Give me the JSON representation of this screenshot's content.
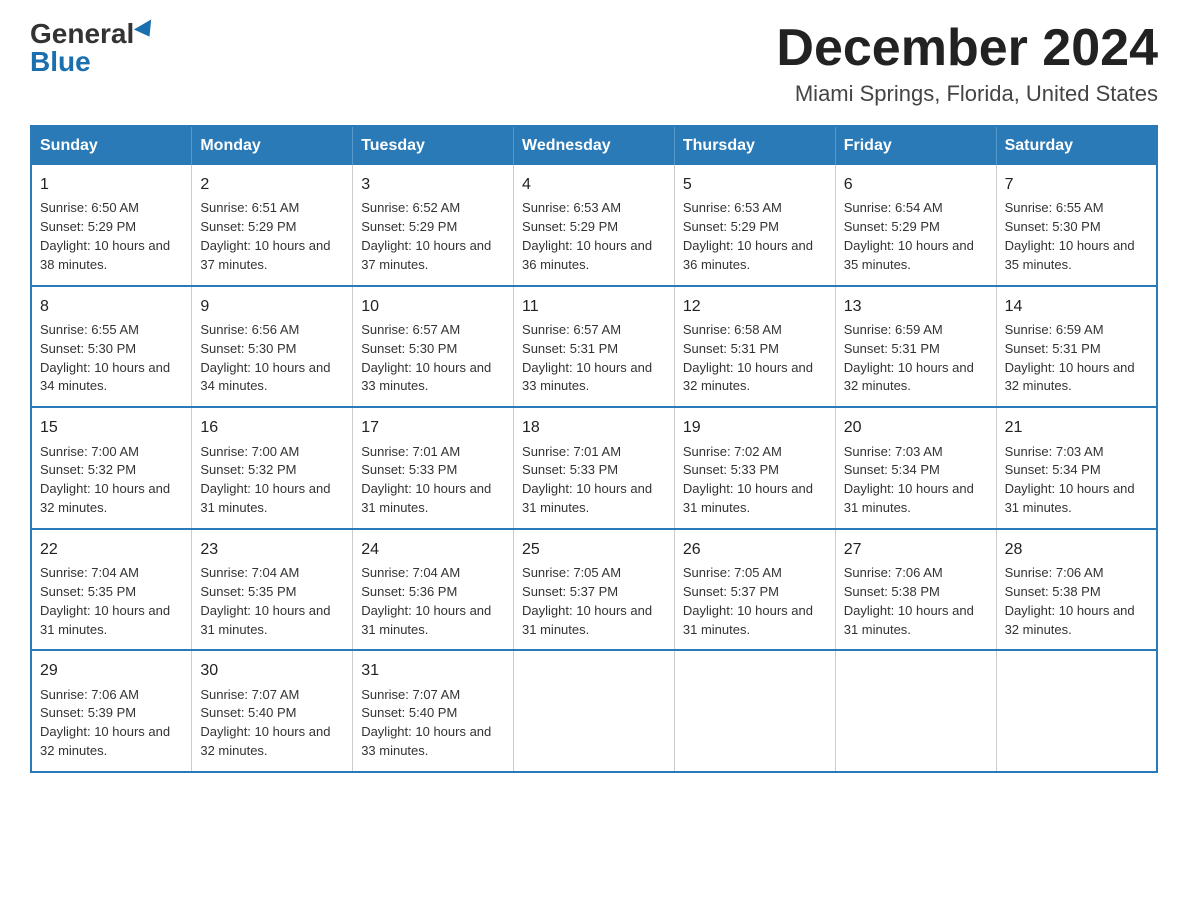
{
  "logo": {
    "general": "General",
    "blue": "Blue"
  },
  "title": "December 2024",
  "subtitle": "Miami Springs, Florida, United States",
  "days_of_week": [
    "Sunday",
    "Monday",
    "Tuesday",
    "Wednesday",
    "Thursday",
    "Friday",
    "Saturday"
  ],
  "weeks": [
    [
      {
        "day": "1",
        "sunrise": "6:50 AM",
        "sunset": "5:29 PM",
        "daylight": "10 hours and 38 minutes."
      },
      {
        "day": "2",
        "sunrise": "6:51 AM",
        "sunset": "5:29 PM",
        "daylight": "10 hours and 37 minutes."
      },
      {
        "day": "3",
        "sunrise": "6:52 AM",
        "sunset": "5:29 PM",
        "daylight": "10 hours and 37 minutes."
      },
      {
        "day": "4",
        "sunrise": "6:53 AM",
        "sunset": "5:29 PM",
        "daylight": "10 hours and 36 minutes."
      },
      {
        "day": "5",
        "sunrise": "6:53 AM",
        "sunset": "5:29 PM",
        "daylight": "10 hours and 36 minutes."
      },
      {
        "day": "6",
        "sunrise": "6:54 AM",
        "sunset": "5:29 PM",
        "daylight": "10 hours and 35 minutes."
      },
      {
        "day": "7",
        "sunrise": "6:55 AM",
        "sunset": "5:30 PM",
        "daylight": "10 hours and 35 minutes."
      }
    ],
    [
      {
        "day": "8",
        "sunrise": "6:55 AM",
        "sunset": "5:30 PM",
        "daylight": "10 hours and 34 minutes."
      },
      {
        "day": "9",
        "sunrise": "6:56 AM",
        "sunset": "5:30 PM",
        "daylight": "10 hours and 34 minutes."
      },
      {
        "day": "10",
        "sunrise": "6:57 AM",
        "sunset": "5:30 PM",
        "daylight": "10 hours and 33 minutes."
      },
      {
        "day": "11",
        "sunrise": "6:57 AM",
        "sunset": "5:31 PM",
        "daylight": "10 hours and 33 minutes."
      },
      {
        "day": "12",
        "sunrise": "6:58 AM",
        "sunset": "5:31 PM",
        "daylight": "10 hours and 32 minutes."
      },
      {
        "day": "13",
        "sunrise": "6:59 AM",
        "sunset": "5:31 PM",
        "daylight": "10 hours and 32 minutes."
      },
      {
        "day": "14",
        "sunrise": "6:59 AM",
        "sunset": "5:31 PM",
        "daylight": "10 hours and 32 minutes."
      }
    ],
    [
      {
        "day": "15",
        "sunrise": "7:00 AM",
        "sunset": "5:32 PM",
        "daylight": "10 hours and 32 minutes."
      },
      {
        "day": "16",
        "sunrise": "7:00 AM",
        "sunset": "5:32 PM",
        "daylight": "10 hours and 31 minutes."
      },
      {
        "day": "17",
        "sunrise": "7:01 AM",
        "sunset": "5:33 PM",
        "daylight": "10 hours and 31 minutes."
      },
      {
        "day": "18",
        "sunrise": "7:01 AM",
        "sunset": "5:33 PM",
        "daylight": "10 hours and 31 minutes."
      },
      {
        "day": "19",
        "sunrise": "7:02 AM",
        "sunset": "5:33 PM",
        "daylight": "10 hours and 31 minutes."
      },
      {
        "day": "20",
        "sunrise": "7:03 AM",
        "sunset": "5:34 PM",
        "daylight": "10 hours and 31 minutes."
      },
      {
        "day": "21",
        "sunrise": "7:03 AM",
        "sunset": "5:34 PM",
        "daylight": "10 hours and 31 minutes."
      }
    ],
    [
      {
        "day": "22",
        "sunrise": "7:04 AM",
        "sunset": "5:35 PM",
        "daylight": "10 hours and 31 minutes."
      },
      {
        "day": "23",
        "sunrise": "7:04 AM",
        "sunset": "5:35 PM",
        "daylight": "10 hours and 31 minutes."
      },
      {
        "day": "24",
        "sunrise": "7:04 AM",
        "sunset": "5:36 PM",
        "daylight": "10 hours and 31 minutes."
      },
      {
        "day": "25",
        "sunrise": "7:05 AM",
        "sunset": "5:37 PM",
        "daylight": "10 hours and 31 minutes."
      },
      {
        "day": "26",
        "sunrise": "7:05 AM",
        "sunset": "5:37 PM",
        "daylight": "10 hours and 31 minutes."
      },
      {
        "day": "27",
        "sunrise": "7:06 AM",
        "sunset": "5:38 PM",
        "daylight": "10 hours and 31 minutes."
      },
      {
        "day": "28",
        "sunrise": "7:06 AM",
        "sunset": "5:38 PM",
        "daylight": "10 hours and 32 minutes."
      }
    ],
    [
      {
        "day": "29",
        "sunrise": "7:06 AM",
        "sunset": "5:39 PM",
        "daylight": "10 hours and 32 minutes."
      },
      {
        "day": "30",
        "sunrise": "7:07 AM",
        "sunset": "5:40 PM",
        "daylight": "10 hours and 32 minutes."
      },
      {
        "day": "31",
        "sunrise": "7:07 AM",
        "sunset": "5:40 PM",
        "daylight": "10 hours and 33 minutes."
      },
      null,
      null,
      null,
      null
    ]
  ]
}
